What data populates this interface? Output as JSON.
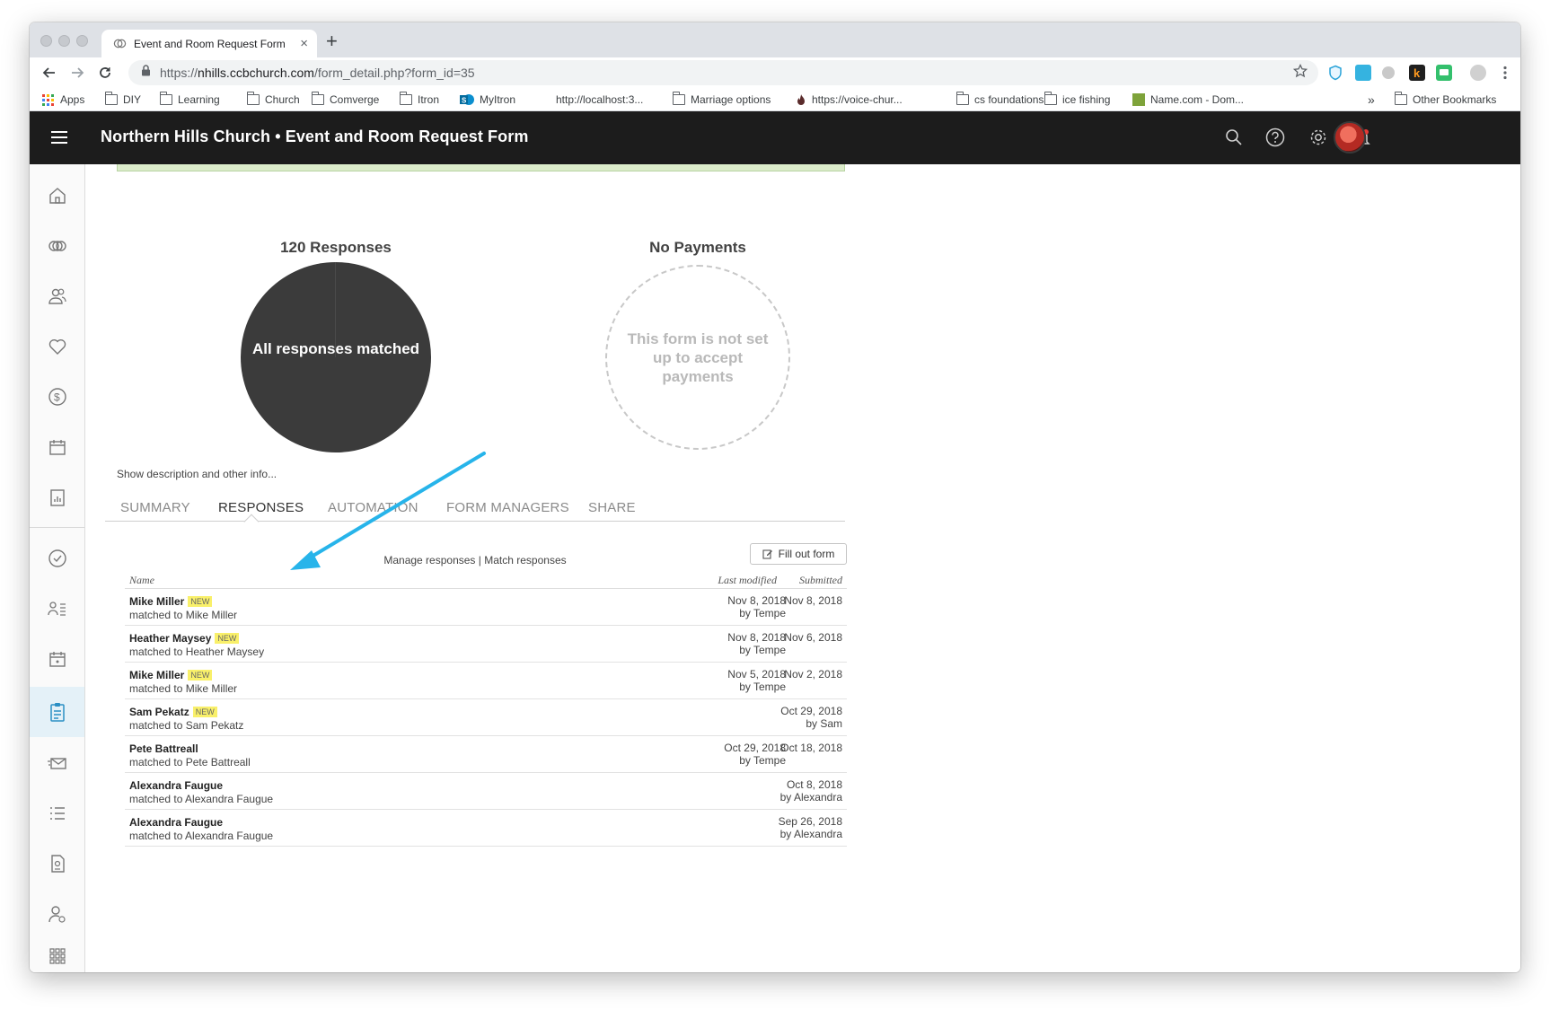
{
  "browser": {
    "tab_title": "Event and Room Request Form",
    "new_tab": "+",
    "tab_close": "×",
    "url_prefix": "https://",
    "url_host": "nhills.ccbchurch.com",
    "url_path": "/form_detail.php?form_id=35",
    "bookmarks": [
      {
        "label": "Apps",
        "icon": "apps-grid-icon"
      },
      {
        "label": "DIY",
        "icon": "folder-icon"
      },
      {
        "label": "Learning",
        "icon": "folder-icon"
      },
      {
        "label": "Church",
        "icon": "folder-icon"
      },
      {
        "label": "Comverge",
        "icon": "folder-icon"
      },
      {
        "label": "Itron",
        "icon": "folder-icon"
      },
      {
        "label": "MyItron",
        "icon": "sharepoint-icon"
      },
      {
        "label": "http://localhost:3...",
        "icon": "none"
      },
      {
        "label": "Marriage options",
        "icon": "folder-icon"
      },
      {
        "label": "https://voice-chur...",
        "icon": "flame-icon"
      },
      {
        "label": "cs foundations",
        "icon": "folder-icon"
      },
      {
        "label": "ice fishing",
        "icon": "folder-icon"
      },
      {
        "label": "Name.com - Dom...",
        "icon": "namecom-icon"
      }
    ],
    "bookmarks_overflow": "»",
    "other_bookmarks": "Other Bookmarks"
  },
  "app": {
    "title": "Northern Hills Church • Event and Room Request Form"
  },
  "stats": {
    "responses_title": "120 Responses",
    "pie_label": "All responses matched",
    "payments_title": "No Payments",
    "payments_text": "This form is not set up to accept payments"
  },
  "description_link": "Show description and other info...",
  "tabs": [
    "SUMMARY",
    "RESPONSES",
    "AUTOMATION",
    "FORM MANAGERS",
    "SHARE"
  ],
  "active_tab": "RESPONSES",
  "manage_links": {
    "manage": "Manage responses",
    "separator": " | ",
    "match": "Match responses"
  },
  "fill_button": "Fill out form",
  "table": {
    "headers": {
      "name": "Name",
      "modified": "Last modified",
      "submitted": "Submitted"
    },
    "rows": [
      {
        "name": "Mike Miller",
        "badge": "NEW",
        "matched": "matched to Mike Miller",
        "modified_date": "Nov 8, 2018",
        "modified_by": "by Tempe",
        "submitted_date": "Nov 8, 2018",
        "submitted_by": ""
      },
      {
        "name": "Heather Maysey",
        "badge": "NEW",
        "matched": "matched to Heather Maysey",
        "modified_date": "Nov 8, 2018",
        "modified_by": "by Tempe",
        "submitted_date": "Nov 6, 2018",
        "submitted_by": ""
      },
      {
        "name": "Mike Miller",
        "badge": "NEW",
        "matched": "matched to Mike Miller",
        "modified_date": "Nov 5, 2018",
        "modified_by": "by Tempe",
        "submitted_date": "Nov 2, 2018",
        "submitted_by": ""
      },
      {
        "name": "Sam Pekatz",
        "badge": "NEW",
        "matched": "matched to Sam Pekatz",
        "modified_date": "",
        "modified_by": "",
        "submitted_date": "Oct 29, 2018",
        "submitted_by": "by Sam"
      },
      {
        "name": "Pete Battreall",
        "badge": "",
        "matched": "matched to Pete Battreall",
        "modified_date": "Oct 29, 2018",
        "modified_by": "by Tempe",
        "submitted_date": "Oct 18, 2018",
        "submitted_by": ""
      },
      {
        "name": "Alexandra Faugue",
        "badge": "",
        "matched": "matched to Alexandra Faugue",
        "modified_date": "",
        "modified_by": "",
        "submitted_date": "Oct 8, 2018",
        "submitted_by": "by Alexandra"
      },
      {
        "name": "Alexandra Faugue",
        "badge": "",
        "matched": "matched to Alexandra Faugue",
        "modified_date": "",
        "modified_by": "",
        "submitted_date": "Sep 26, 2018",
        "submitted_by": "by Alexandra"
      }
    ]
  },
  "colors": {
    "header_bg": "#1c1c1c",
    "pie_fill": "#3b3b3b",
    "annotation_arrow": "#27b4ea",
    "new_badge": "#f9f06a",
    "sidebar_active": "#e4f1f8"
  }
}
